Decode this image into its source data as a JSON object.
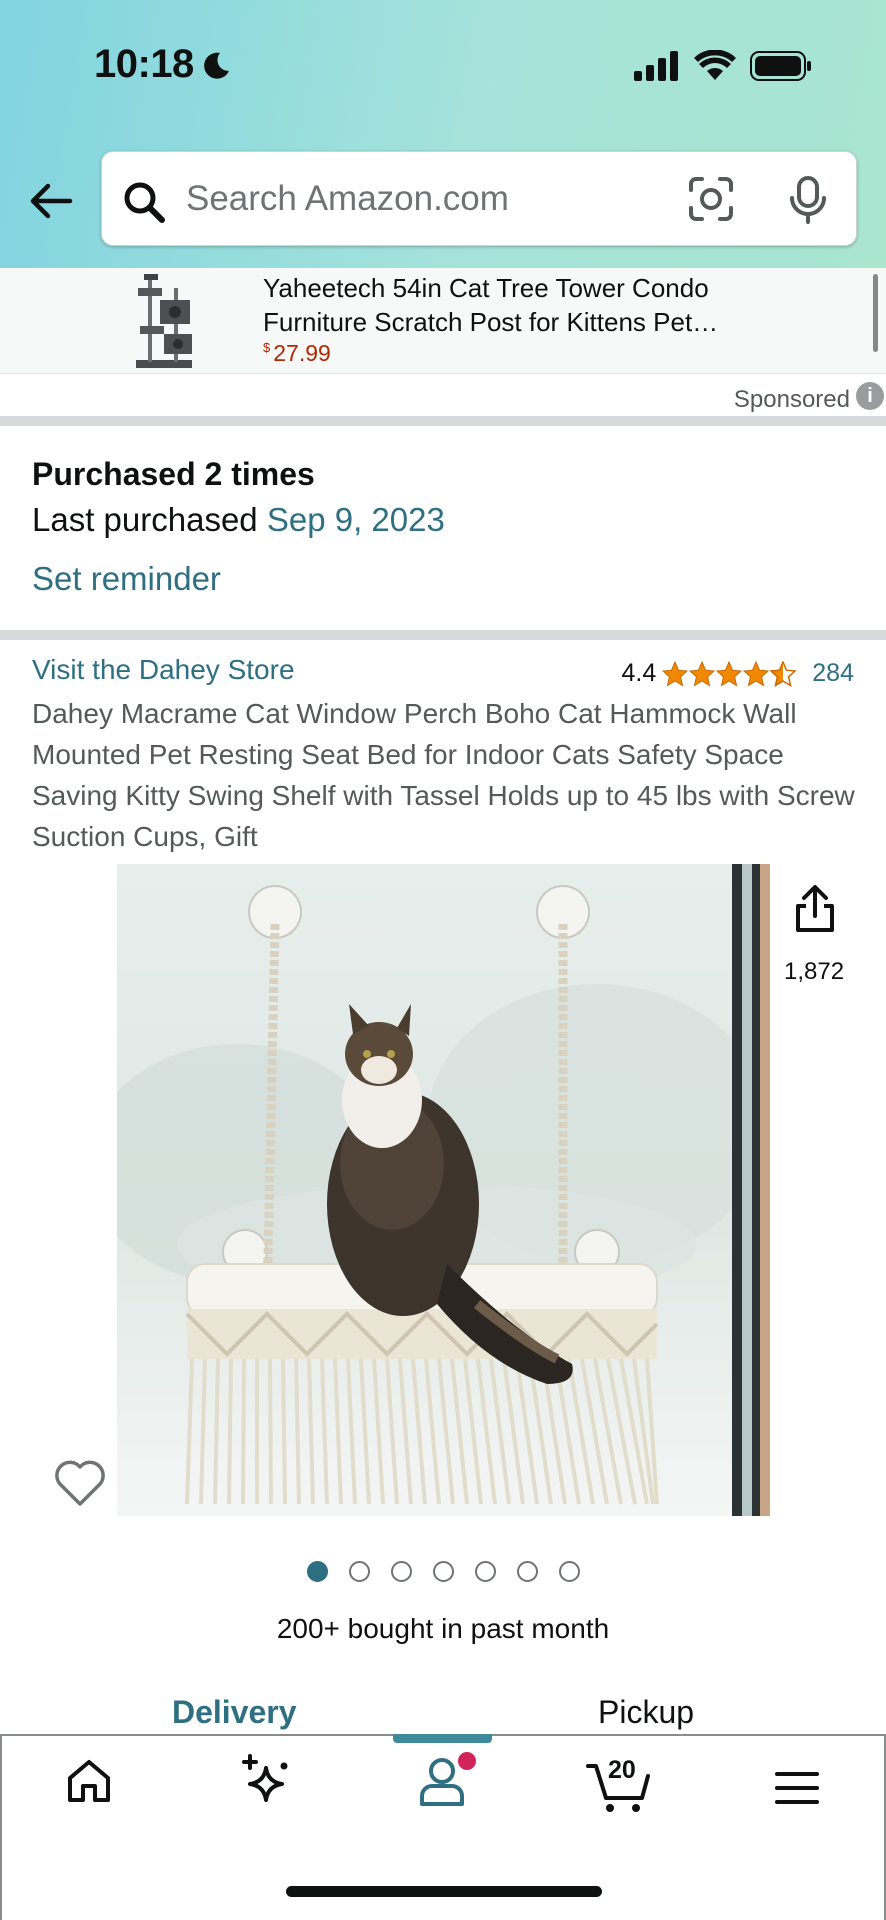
{
  "status_bar": {
    "time": "10:18"
  },
  "search": {
    "placeholder": "Search Amazon.com"
  },
  "sponsored": {
    "title_line1": "Yaheetech 54in Cat Tree Tower Condo",
    "title_line2": "Furniture Scratch Post for Kittens Pet…",
    "price_symbol": "$",
    "price": "27.99",
    "label": "Sponsored",
    "info_glyph": "i"
  },
  "purchase": {
    "times": "Purchased 2 times",
    "last_label": "Last purchased",
    "last_date": "Sep 9, 2023",
    "set_reminder": "Set reminder"
  },
  "product": {
    "store_link": "Visit the Dahey Store",
    "rating": "4.4",
    "rating_stars": 4.4,
    "rating_count": "284",
    "title": "Dahey Macrame Cat Window Perch Boho Cat Hammock Wall Mounted Pet Resting Seat Bed for Indoor Cats Safety Space Saving Kitty Swing Shelf with Tassel Holds up to 45 lbs with Screw Suction Cups, Gift",
    "share_count": "1,872",
    "image_dots_total": 7,
    "image_dot_active": 1,
    "bought_text": "200+ bought in past month"
  },
  "fulfillment_tabs": {
    "delivery": "Delivery",
    "pickup": "Pickup"
  },
  "bottom_nav": {
    "items": [
      "home-icon",
      "sparkle-icon",
      "account-icon",
      "cart-icon",
      "menu-icon"
    ],
    "cart_count": "20"
  },
  "colors": {
    "link": "#2f6f82",
    "price": "#b12704",
    "star": "#f08804",
    "badge": "#d1245a"
  }
}
